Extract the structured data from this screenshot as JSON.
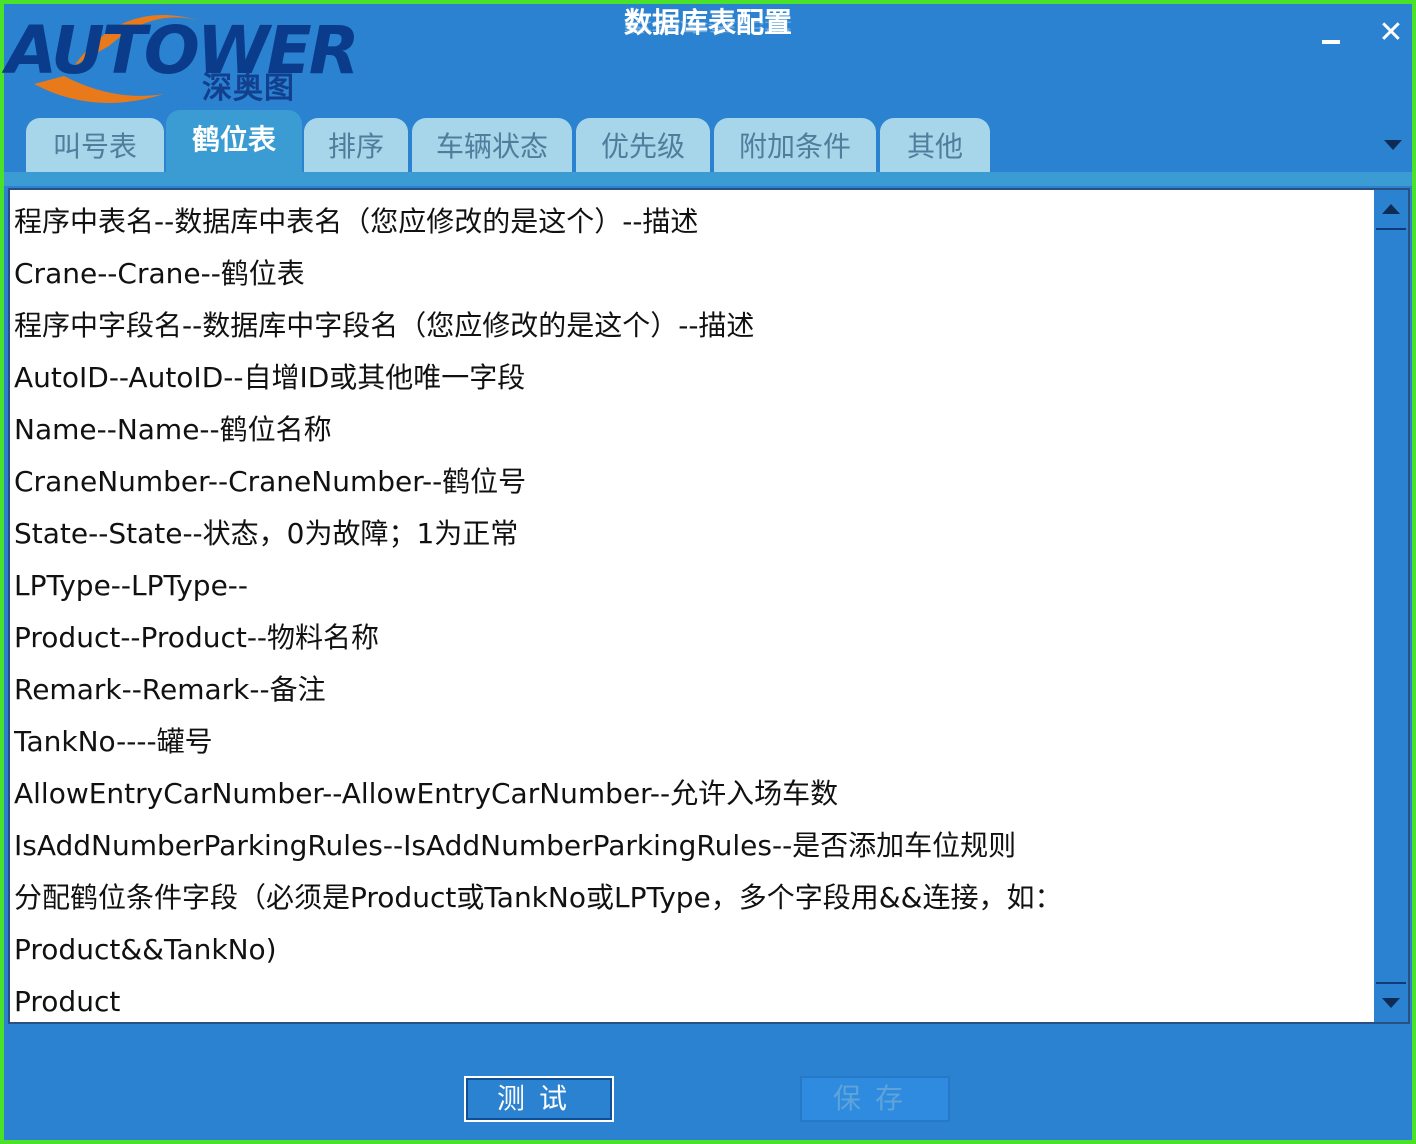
{
  "window": {
    "title": "数据库表配置",
    "logo": {
      "name": "AUTOWER",
      "subtitle": "深奥图"
    },
    "minimize_icon": "minimize-icon",
    "close_label": "✕",
    "colors": {
      "window_bg": "#2a82d0",
      "border": "#49e12a",
      "active_tab": "#3a9cd2",
      "inactive_tab": "#a7d6ea"
    }
  },
  "tabs": [
    {
      "label": "叫号表",
      "active": false
    },
    {
      "label": "鹤位表",
      "active": true
    },
    {
      "label": "排序",
      "active": false
    },
    {
      "label": "车辆状态",
      "active": false
    },
    {
      "label": "优先级",
      "active": false
    },
    {
      "label": "附加条件",
      "active": false
    },
    {
      "label": "其他",
      "active": false
    }
  ],
  "editor": {
    "lines": [
      "程序中表名--数据库中表名（您应修改的是这个）--描述",
      "Crane--Crane--鹤位表",
      "程序中字段名--数据库中字段名（您应修改的是这个）--描述",
      "AutoID--AutoID--自增ID或其他唯一字段",
      "Name--Name--鹤位名称",
      "CraneNumber--CraneNumber--鹤位号",
      "State--State--状态，0为故障；1为正常",
      "LPType--LPType--",
      "Product--Product--物料名称",
      "Remark--Remark--备注",
      "TankNo----罐号",
      "AllowEntryCarNumber--AllowEntryCarNumber--允许入场车数",
      "IsAddNumberParkingRules--IsAddNumberParkingRules--是否添加车位规则",
      "分配鹤位条件字段（必须是Product或TankNo或LPType，多个字段用&&连接，如：",
      "Product&&TankNo)",
      "Product"
    ]
  },
  "buttons": {
    "test_label": "测试",
    "save_label": "保存"
  }
}
